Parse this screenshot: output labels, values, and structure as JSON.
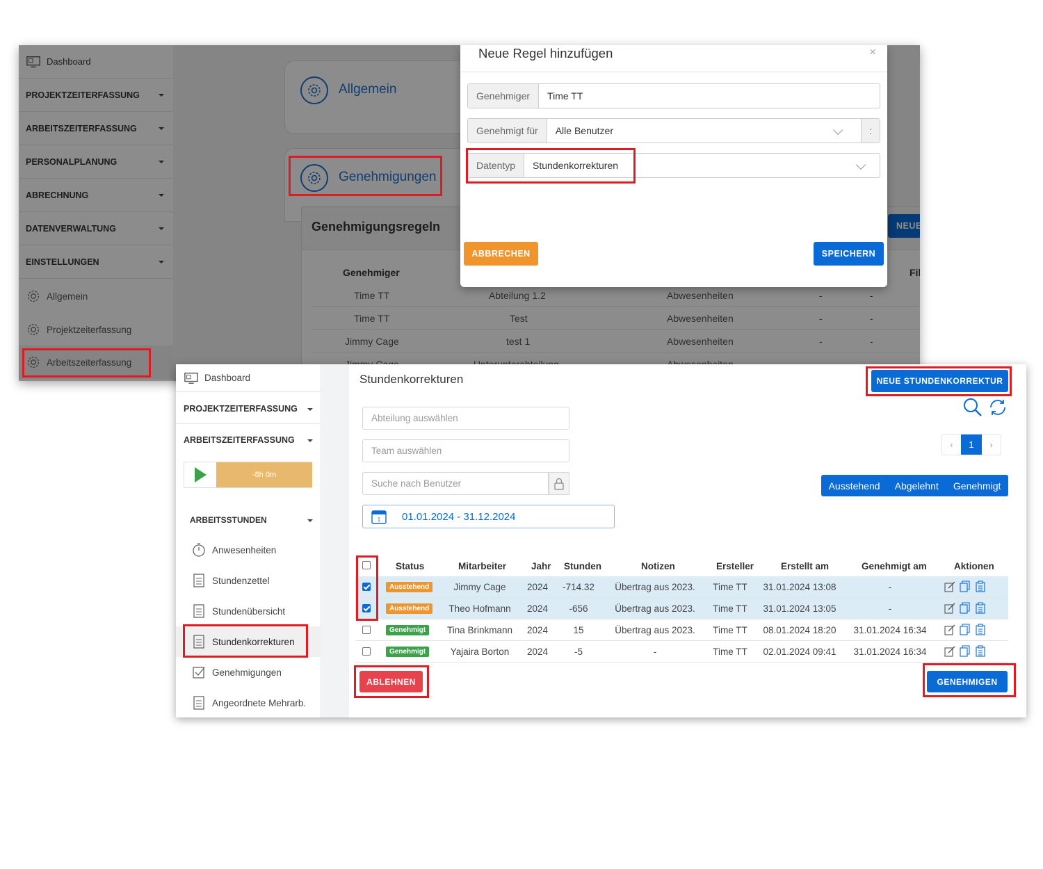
{
  "back": {
    "sidebar": {
      "dashboard": "Dashboard",
      "sections": [
        "PROJEKTZEITERFASSUNG",
        "ARBEITSZEITERFASSUNG",
        "PERSONALPLANUNG",
        "ABRECHNUNG",
        "DATENVERWALTUNG",
        "EINSTELLUNGEN"
      ],
      "sub_items": [
        "Allgemein",
        "Projektzeiterfassung",
        "Arbeitszeiterfassung"
      ]
    },
    "cards": {
      "allgemein": "Allgemein",
      "genehmigungen": "Genehmigungen"
    },
    "rules": {
      "title": "Genehmigungsregeln",
      "new_button": "NEUE",
      "col_genehmiger": "Genehmiger",
      "col_fil": "Fil",
      "rows": [
        [
          "Time TT",
          "Abteilung 1.2",
          "Abwesenheiten",
          "-",
          "-"
        ],
        [
          "Time TT",
          "Test",
          "Abwesenheiten",
          "-",
          "-"
        ],
        [
          "Jimmy Cage",
          "test 1",
          "Abwesenheiten",
          "-",
          "-"
        ],
        [
          "Jimmy Cage",
          "Unterunterabteilung",
          "Abwesenheiten",
          "-",
          "-"
        ]
      ]
    },
    "modal": {
      "title": "Neue Regel hinzufügen",
      "close": "×",
      "genehmiger_label": "Genehmiger",
      "genehmiger_value": "Time TT",
      "genehmigt_fuer_label": "Genehmigt für",
      "genehmigt_fuer_value": "Alle Benutzer",
      "more": ":",
      "datentyp_label": "Datentyp",
      "datentyp_value": "Stundenkorrekturen",
      "cancel": "ABBRECHEN",
      "save": "SPEICHERN"
    }
  },
  "front": {
    "sidebar": {
      "dashboard": "Dashboard",
      "sec1": "PROJEKTZEITERFASSUNG",
      "sec2": "ARBEITSZEITERFASSUNG",
      "timer": "-8h 0m",
      "sec3": "ARBEITSSTUNDEN",
      "items": [
        "Anwesenheiten",
        "Stundenzettel",
        "Stundenübersicht",
        "Stundenkorrekturen",
        "Genehmigungen",
        "Angeordnete Mehrarb."
      ]
    },
    "title": "Stundenkorrekturen",
    "new_button": "NEUE STUNDENKORREKTUR",
    "filters": {
      "abteilung": "Abteilung auswählen",
      "team": "Team auswählen",
      "search": "Suche nach Benutzer",
      "date_range": "01.01.2024 - 31.12.2024"
    },
    "pagination": {
      "prev": "‹",
      "page": "1",
      "next": "›"
    },
    "status_tabs": [
      "Ausstehend",
      "Abgelehnt",
      "Genehmigt"
    ],
    "table": {
      "headers": [
        "Status",
        "Mitarbeiter",
        "Jahr",
        "Stunden",
        "Notizen",
        "Ersteller",
        "Erstellt am",
        "Genehmigt am",
        "Aktionen"
      ],
      "rows": [
        {
          "status": "Ausstehend",
          "name": "Jimmy Cage",
          "year": "2024",
          "hours": "-714.32",
          "notes": "Übertrag aus 2023.",
          "creator": "Time TT",
          "created": "31.01.2024 13:08",
          "approved": "-",
          "checked": true
        },
        {
          "status": "Ausstehend",
          "name": "Theo Hofmann",
          "year": "2024",
          "hours": "-656",
          "notes": "Übertrag aus 2023.",
          "creator": "Time TT",
          "created": "31.01.2024 13:05",
          "approved": "-",
          "checked": true
        },
        {
          "status": "Genehmigt",
          "name": "Tina Brinkmann",
          "year": "2024",
          "hours": "15",
          "notes": "Übertrag aus 2023.",
          "creator": "Time TT",
          "created": "08.01.2024 18:20",
          "approved": "31.01.2024 16:34",
          "checked": false
        },
        {
          "status": "Genehmigt",
          "name": "Yajaira Borton",
          "year": "2024",
          "hours": "-5",
          "notes": "-",
          "creator": "Time TT",
          "created": "02.01.2024 09:41",
          "approved": "31.01.2024 16:34",
          "checked": false
        }
      ]
    },
    "reject_button": "ABLEHNEN",
    "approve_button": "GENEHMIGEN"
  },
  "colors": {
    "primary": "#0a6ad6",
    "orange": "#f0952b",
    "red": "#e8434c",
    "green": "#3aa34a",
    "highlight": "#e01b22"
  }
}
